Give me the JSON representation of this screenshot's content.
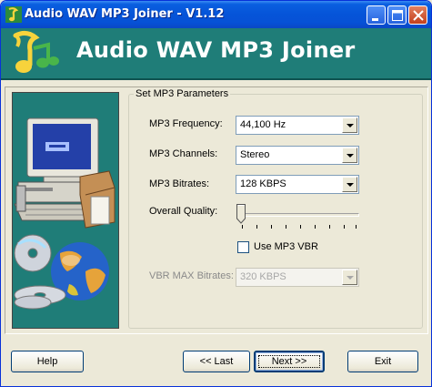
{
  "window": {
    "title": "Audio WAV MP3 Joiner - V1.12"
  },
  "header": {
    "title": "Audio WAV MP3 Joiner"
  },
  "group": {
    "legend": "Set MP3 Parameters"
  },
  "fields": {
    "frequency": {
      "label": "MP3 Frequency:",
      "value": "44,100 Hz"
    },
    "channels": {
      "label": "MP3 Channels:",
      "value": "Stereo"
    },
    "bitrates": {
      "label": "MP3 Bitrates:",
      "value": "128 KBPS"
    },
    "quality": {
      "label": "Overall Quality:",
      "level": 0
    },
    "vbr": {
      "label": "Use MP3 VBR",
      "checked": false
    },
    "vbr_max": {
      "label": "VBR MAX Bitrates:",
      "value": "320 KBPS",
      "disabled": true
    }
  },
  "buttons": {
    "help": "Help",
    "last": "<< Last",
    "next": "Next >>",
    "exit": "Exit"
  },
  "colors": {
    "header_bg": "#1f7d78",
    "titlebar": "#0554d8"
  }
}
